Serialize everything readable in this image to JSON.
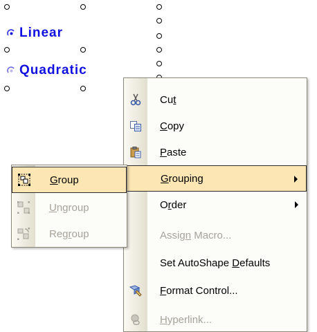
{
  "controls": {
    "linear": {
      "label": "Linear",
      "selected": true
    },
    "quadratic": {
      "label": "Quadratic",
      "selected": false
    }
  },
  "menu": {
    "items": [
      {
        "before": "Cu",
        "key": "t",
        "after": "",
        "icon": "scissors-icon",
        "disabled": false
      },
      {
        "before": "",
        "key": "C",
        "after": "opy",
        "icon": "copy-icon",
        "disabled": false
      },
      {
        "before": "",
        "key": "P",
        "after": "aste",
        "icon": "paste-icon",
        "disabled": false
      },
      {
        "before": "",
        "key": "G",
        "after": "rouping",
        "icon": "",
        "disabled": false,
        "highlighted": true,
        "submenu": true
      },
      {
        "before": "O",
        "key": "r",
        "after": "der",
        "icon": "",
        "disabled": false,
        "submenu": true
      },
      {
        "before": "Assig",
        "key": "n",
        "after": " Macro...",
        "icon": "",
        "disabled": true
      },
      {
        "before": "Set AutoShape ",
        "key": "D",
        "after": "efaults",
        "icon": "",
        "disabled": false
      },
      {
        "before": "",
        "key": "F",
        "after": "ormat Control...",
        "icon": "format-control-icon",
        "disabled": false
      },
      {
        "before": "",
        "key": "H",
        "after": "yperlink...",
        "icon": "hyperlink-icon",
        "disabled": true
      }
    ]
  },
  "submenu": {
    "items": [
      {
        "before": "",
        "key": "G",
        "after": "roup",
        "icon": "group-icon",
        "disabled": false,
        "highlighted": true
      },
      {
        "before": "",
        "key": "U",
        "after": "ngroup",
        "icon": "ungroup-icon",
        "disabled": true
      },
      {
        "before": "Reg",
        "key": "r",
        "after": "oup",
        "icon": "regroup-icon",
        "disabled": true
      }
    ]
  },
  "colors": {
    "control_text": "#1010e0",
    "highlight": "#fce6b4",
    "disabled_text": "#a6a39a"
  }
}
